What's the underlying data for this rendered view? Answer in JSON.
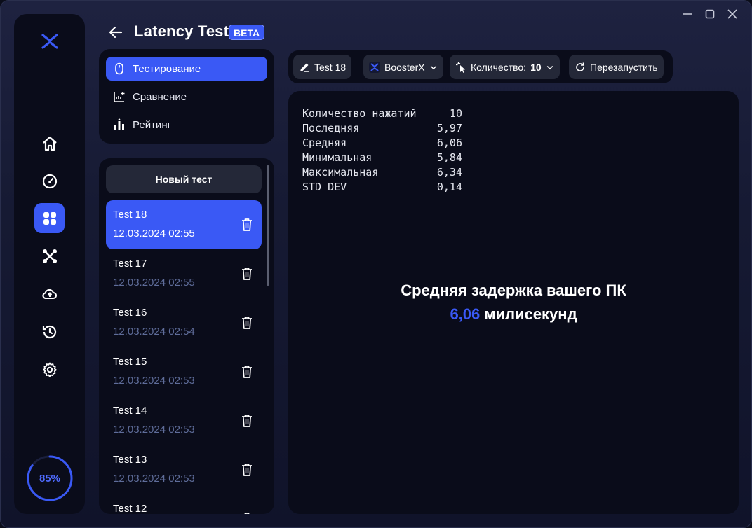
{
  "window": {
    "minimize": "—",
    "maximize": "□",
    "close": "✕"
  },
  "header": {
    "title": "Latency Test",
    "badge": "BETA"
  },
  "rail": {
    "items": [
      "home-icon",
      "speedometer-icon",
      "apps-icon",
      "network-icon",
      "cloud-upload-icon",
      "history-icon",
      "gear-icon"
    ],
    "active_index": 2,
    "gauge_label": "85%",
    "gauge_value": 0.85
  },
  "nav": {
    "items": [
      {
        "label": "Тестирование",
        "icon": "mouse-icon"
      },
      {
        "label": "Сравнение",
        "icon": "chart-add-icon"
      },
      {
        "label": "Рейтинг",
        "icon": "bars-icon"
      }
    ]
  },
  "list": {
    "new_test": "Новый тест",
    "items": [
      {
        "name": "Test 18",
        "date": "12.03.2024 02:55"
      },
      {
        "name": "Test 17",
        "date": "12.03.2024 02:55"
      },
      {
        "name": "Test 16",
        "date": "12.03.2024 02:54"
      },
      {
        "name": "Test 15",
        "date": "12.03.2024 02:53"
      },
      {
        "name": "Test 14",
        "date": "12.03.2024 02:53"
      },
      {
        "name": "Test 13",
        "date": "12.03.2024 02:53"
      },
      {
        "name": "Test 12",
        "date": ""
      }
    ]
  },
  "toolbar": {
    "rename": "Test 18",
    "profile": "BoosterX",
    "count_label": "Количество:",
    "count_value": "10",
    "restart": "Перезапустить"
  },
  "stats": [
    {
      "label": "Количество нажатий",
      "value": "10"
    },
    {
      "label": "Последняя",
      "value": "5,97"
    },
    {
      "label": "Средняя",
      "value": "6,06"
    },
    {
      "label": "Минимальная",
      "value": "5,84"
    },
    {
      "label": "Максимальная",
      "value": "6,34"
    },
    {
      "label": "STD DEV",
      "value": "0,14"
    }
  ],
  "result": {
    "headline": "Средняя задержка вашего ПК",
    "value": "6,06",
    "unit": "милисекунд"
  },
  "colors": {
    "accent": "#3a59f5",
    "panel": "#0a0c1a",
    "muted": "#5f6d9a"
  }
}
